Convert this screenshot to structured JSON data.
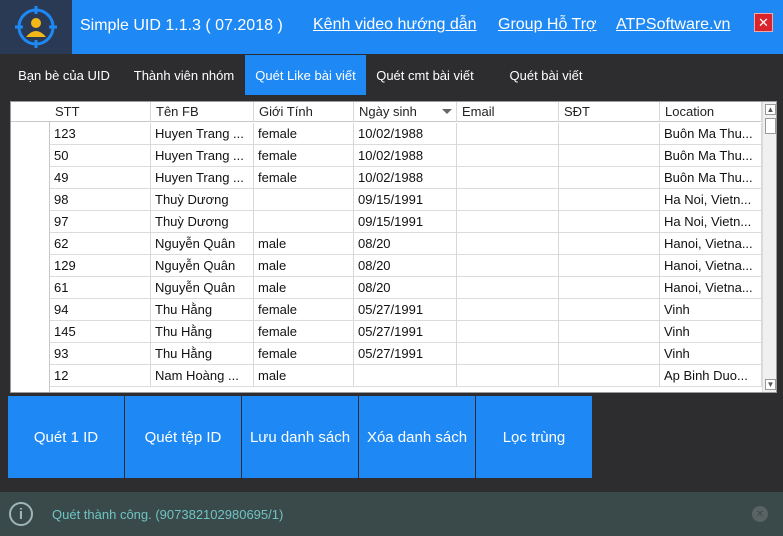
{
  "app": {
    "title": "Simple UID 1.1.3 ( 07.2018 )",
    "links": [
      "Kênh video hướng dẫn",
      "Group Hỗ Trợ",
      "ATPSoftware.vn"
    ],
    "close_glyph": "✕"
  },
  "tabs": [
    {
      "label": "Bạn bè của UID",
      "active": false
    },
    {
      "label": "Thành viên nhóm",
      "active": false
    },
    {
      "label": "Quét Like bài viết",
      "active": true
    },
    {
      "label": "Quét cmt bài viết",
      "active": false
    },
    {
      "label": "Quét bài viết",
      "active": false
    }
  ],
  "table": {
    "columns": [
      "STT",
      "Tên FB",
      "Giới Tính",
      "Ngày sinh",
      "Email",
      "SĐT",
      "Location"
    ],
    "rows": [
      [
        "123",
        "Huyen Trang ...",
        "female",
        "10/02/1988",
        "",
        "",
        "Buôn Ma Thu..."
      ],
      [
        "50",
        "Huyen Trang ...",
        "female",
        "10/02/1988",
        "",
        "",
        "Buôn Ma Thu..."
      ],
      [
        "49",
        "Huyen Trang ...",
        "female",
        "10/02/1988",
        "",
        "",
        "Buôn Ma Thu..."
      ],
      [
        "98",
        "Thuỳ Dương",
        "",
        "09/15/1991",
        "",
        "",
        "Ha Noi, Vietn..."
      ],
      [
        "97",
        "Thuỳ Dương",
        "",
        "09/15/1991",
        "",
        "",
        "Ha Noi, Vietn..."
      ],
      [
        "62",
        "Nguyễn Quân",
        "male",
        "08/20",
        "",
        "",
        "Hanoi, Vietna..."
      ],
      [
        "129",
        "Nguyễn Quân",
        "male",
        "08/20",
        "",
        "",
        "Hanoi, Vietna..."
      ],
      [
        "61",
        "Nguyễn Quân",
        "male",
        "08/20",
        "",
        "",
        "Hanoi, Vietna..."
      ],
      [
        "94",
        "Thu Hằng",
        "female",
        "05/27/1991",
        "",
        "",
        "Vinh"
      ],
      [
        "145",
        "Thu Hằng",
        "female",
        "05/27/1991",
        "",
        "",
        "Vinh"
      ],
      [
        "93",
        "Thu Hằng",
        "female",
        "05/27/1991",
        "",
        "",
        "Vinh"
      ],
      [
        "12",
        "Nam Hoàng ...",
        "male",
        "",
        "",
        "",
        "Ap Binh Duo..."
      ]
    ]
  },
  "actions": [
    "Quét 1 ID",
    "Quét tệp ID",
    "Lưu danh sách",
    "Xóa danh sách",
    "Lọc trùng"
  ],
  "status": {
    "text": "Quét thành công. (907382102980695/1)"
  },
  "colors": {
    "accent": "#1e88f5",
    "background": "#2d2d30",
    "status_bg": "#3a4a4a",
    "status_text": "#6fc3c5",
    "close_red": "#d9242b"
  }
}
